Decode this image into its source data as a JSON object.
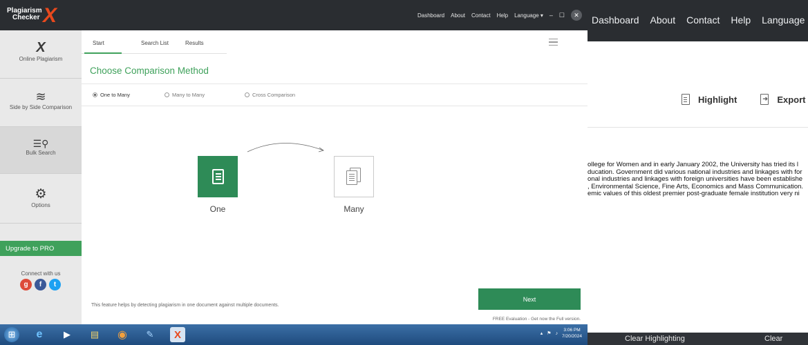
{
  "background_window": {
    "nav": [
      "Dashboard",
      "About",
      "Contact",
      "Help",
      "Language"
    ],
    "tools": {
      "highlight": "Highlight",
      "export": "Export"
    },
    "text_lines": [
      "ollege for Women and in early January 2002, the University has tried its l",
      "ducation. Government did various national industries and linkages with for",
      "onal industries and linkages with foreign universities have been establishe",
      ", Environmental Science, Fine Arts, Economics and Mass Communication.",
      "emic values of this oldest premier post-graduate female institution very ni"
    ],
    "bottom": {
      "clear_highlighting": "Clear Highlighting",
      "clear": "Clear"
    }
  },
  "app": {
    "logo_text_1": "Plagiarism",
    "logo_text_2": "Checker",
    "nav": [
      "Dashboard",
      "About",
      "Contact",
      "Help",
      "Language"
    ],
    "sidebar": {
      "items": [
        {
          "label": "Online Plagiarism",
          "icon": "x-logo-icon"
        },
        {
          "label": "Side by Side Comparison",
          "icon": "layers-icon"
        },
        {
          "label": "Bulk Search",
          "icon": "search-list-icon"
        },
        {
          "label": "Options",
          "icon": "gear-icon"
        }
      ],
      "upgrade": "Upgrade to PRO",
      "connect": "Connect with us"
    },
    "tabs": [
      "Start",
      "Search List",
      "Results"
    ],
    "heading": "Choose Comparison Method",
    "radios": [
      "One to Many",
      "Many to Many",
      "Cross Comparison"
    ],
    "one_label": "One",
    "many_label": "Many",
    "description": "This feature helps by detecting plagiarism in one document against multiple documents.",
    "next": "Next",
    "free": "FREE Evaluation - Get now the Full version.",
    "accent": "#3fa15b"
  },
  "taskbar": {
    "time": "3:06 PM",
    "date": "7/20/2024"
  }
}
